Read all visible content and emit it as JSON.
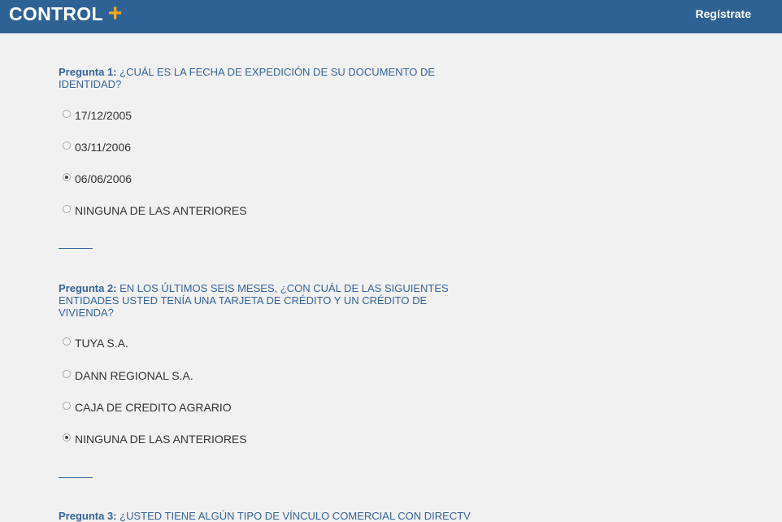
{
  "header": {
    "brand": "CONTROL",
    "brand_plus": "+",
    "register_label": "Regístrate"
  },
  "questions": [
    {
      "label": "Pregunta 1:",
      "text": "¿CUÁL ES LA FECHA DE EXPEDICIÓN DE SU DOCUMENTO DE IDENTIDAD?",
      "options": [
        {
          "label": "17/12/2005",
          "selected": false
        },
        {
          "label": "03/11/2006",
          "selected": false
        },
        {
          "label": "06/06/2006",
          "selected": true
        },
        {
          "label": "NINGUNA DE LAS ANTERIORES",
          "selected": false
        }
      ]
    },
    {
      "label": "Pregunta 2:",
      "text": "EN LOS ÚLTIMOS SEIS MESES, ¿CON CUÁL DE LAS SIGUIENTES ENTIDADES USTED TENÍA UNA TARJETA DE CRÉDITO Y UN CRÉDITO DE VIVIENDA?",
      "options": [
        {
          "label": "TUYA S.A.",
          "selected": false
        },
        {
          "label": "DANN REGIONAL S.A.",
          "selected": false
        },
        {
          "label": "CAJA DE CREDITO AGRARIO",
          "selected": false
        },
        {
          "label": "NINGUNA DE LAS ANTERIORES",
          "selected": true
        }
      ]
    },
    {
      "label": "Pregunta 3:",
      "text": "¿USTED TIENE ALGÚN TIPO DE VÍNCULO COMERCIAL CON DIRECTV"
    }
  ]
}
